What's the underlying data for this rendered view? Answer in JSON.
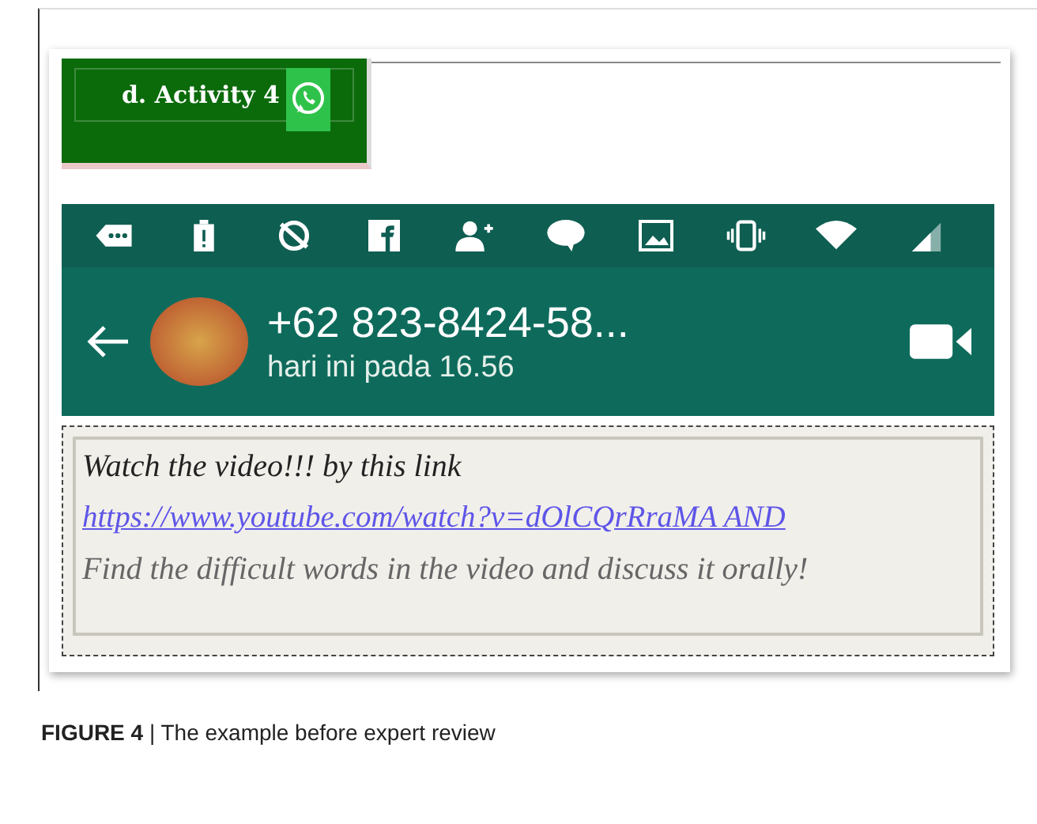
{
  "banner": {
    "title": "d. Activity 4"
  },
  "chat_header": {
    "contact": "+62 823-8424-58...",
    "last_seen": "hari ini pada 16.56"
  },
  "message": [
    {
      "kind": "text",
      "text": "Watch the video!!!  by this link"
    },
    {
      "kind": "link",
      "text": "https://www.youtube.com/watch?v=dOlCQrRraMA AND"
    },
    {
      "kind": "text",
      "text": "Find the difficult words in the video and discuss it orally!"
    }
  ],
  "caption": "**FIGURE 4** | The example before expert review"
}
